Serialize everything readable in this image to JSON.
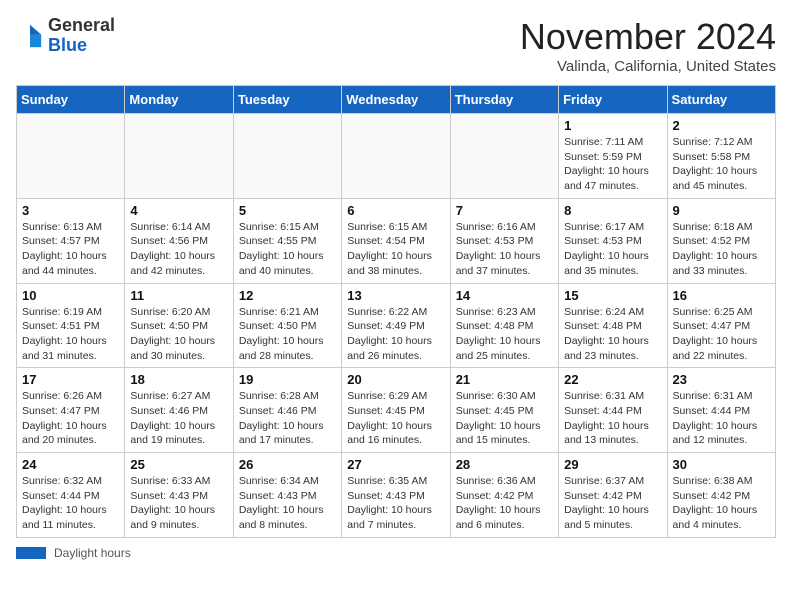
{
  "header": {
    "logo_general": "General",
    "logo_blue": "Blue",
    "month_title": "November 2024",
    "location": "Valinda, California, United States"
  },
  "days_of_week": [
    "Sunday",
    "Monday",
    "Tuesday",
    "Wednesday",
    "Thursday",
    "Friday",
    "Saturday"
  ],
  "weeks": [
    [
      {
        "day": "",
        "info": ""
      },
      {
        "day": "",
        "info": ""
      },
      {
        "day": "",
        "info": ""
      },
      {
        "day": "",
        "info": ""
      },
      {
        "day": "",
        "info": ""
      },
      {
        "day": "1",
        "info": "Sunrise: 7:11 AM\nSunset: 5:59 PM\nDaylight: 10 hours and 47 minutes."
      },
      {
        "day": "2",
        "info": "Sunrise: 7:12 AM\nSunset: 5:58 PM\nDaylight: 10 hours and 45 minutes."
      }
    ],
    [
      {
        "day": "3",
        "info": "Sunrise: 6:13 AM\nSunset: 4:57 PM\nDaylight: 10 hours and 44 minutes."
      },
      {
        "day": "4",
        "info": "Sunrise: 6:14 AM\nSunset: 4:56 PM\nDaylight: 10 hours and 42 minutes."
      },
      {
        "day": "5",
        "info": "Sunrise: 6:15 AM\nSunset: 4:55 PM\nDaylight: 10 hours and 40 minutes."
      },
      {
        "day": "6",
        "info": "Sunrise: 6:15 AM\nSunset: 4:54 PM\nDaylight: 10 hours and 38 minutes."
      },
      {
        "day": "7",
        "info": "Sunrise: 6:16 AM\nSunset: 4:53 PM\nDaylight: 10 hours and 37 minutes."
      },
      {
        "day": "8",
        "info": "Sunrise: 6:17 AM\nSunset: 4:53 PM\nDaylight: 10 hours and 35 minutes."
      },
      {
        "day": "9",
        "info": "Sunrise: 6:18 AM\nSunset: 4:52 PM\nDaylight: 10 hours and 33 minutes."
      }
    ],
    [
      {
        "day": "10",
        "info": "Sunrise: 6:19 AM\nSunset: 4:51 PM\nDaylight: 10 hours and 31 minutes."
      },
      {
        "day": "11",
        "info": "Sunrise: 6:20 AM\nSunset: 4:50 PM\nDaylight: 10 hours and 30 minutes."
      },
      {
        "day": "12",
        "info": "Sunrise: 6:21 AM\nSunset: 4:50 PM\nDaylight: 10 hours and 28 minutes."
      },
      {
        "day": "13",
        "info": "Sunrise: 6:22 AM\nSunset: 4:49 PM\nDaylight: 10 hours and 26 minutes."
      },
      {
        "day": "14",
        "info": "Sunrise: 6:23 AM\nSunset: 4:48 PM\nDaylight: 10 hours and 25 minutes."
      },
      {
        "day": "15",
        "info": "Sunrise: 6:24 AM\nSunset: 4:48 PM\nDaylight: 10 hours and 23 minutes."
      },
      {
        "day": "16",
        "info": "Sunrise: 6:25 AM\nSunset: 4:47 PM\nDaylight: 10 hours and 22 minutes."
      }
    ],
    [
      {
        "day": "17",
        "info": "Sunrise: 6:26 AM\nSunset: 4:47 PM\nDaylight: 10 hours and 20 minutes."
      },
      {
        "day": "18",
        "info": "Sunrise: 6:27 AM\nSunset: 4:46 PM\nDaylight: 10 hours and 19 minutes."
      },
      {
        "day": "19",
        "info": "Sunrise: 6:28 AM\nSunset: 4:46 PM\nDaylight: 10 hours and 17 minutes."
      },
      {
        "day": "20",
        "info": "Sunrise: 6:29 AM\nSunset: 4:45 PM\nDaylight: 10 hours and 16 minutes."
      },
      {
        "day": "21",
        "info": "Sunrise: 6:30 AM\nSunset: 4:45 PM\nDaylight: 10 hours and 15 minutes."
      },
      {
        "day": "22",
        "info": "Sunrise: 6:31 AM\nSunset: 4:44 PM\nDaylight: 10 hours and 13 minutes."
      },
      {
        "day": "23",
        "info": "Sunrise: 6:31 AM\nSunset: 4:44 PM\nDaylight: 10 hours and 12 minutes."
      }
    ],
    [
      {
        "day": "24",
        "info": "Sunrise: 6:32 AM\nSunset: 4:44 PM\nDaylight: 10 hours and 11 minutes."
      },
      {
        "day": "25",
        "info": "Sunrise: 6:33 AM\nSunset: 4:43 PM\nDaylight: 10 hours and 9 minutes."
      },
      {
        "day": "26",
        "info": "Sunrise: 6:34 AM\nSunset: 4:43 PM\nDaylight: 10 hours and 8 minutes."
      },
      {
        "day": "27",
        "info": "Sunrise: 6:35 AM\nSunset: 4:43 PM\nDaylight: 10 hours and 7 minutes."
      },
      {
        "day": "28",
        "info": "Sunrise: 6:36 AM\nSunset: 4:42 PM\nDaylight: 10 hours and 6 minutes."
      },
      {
        "day": "29",
        "info": "Sunrise: 6:37 AM\nSunset: 4:42 PM\nDaylight: 10 hours and 5 minutes."
      },
      {
        "day": "30",
        "info": "Sunrise: 6:38 AM\nSunset: 4:42 PM\nDaylight: 10 hours and 4 minutes."
      }
    ]
  ],
  "legend": {
    "label": "Daylight hours"
  }
}
